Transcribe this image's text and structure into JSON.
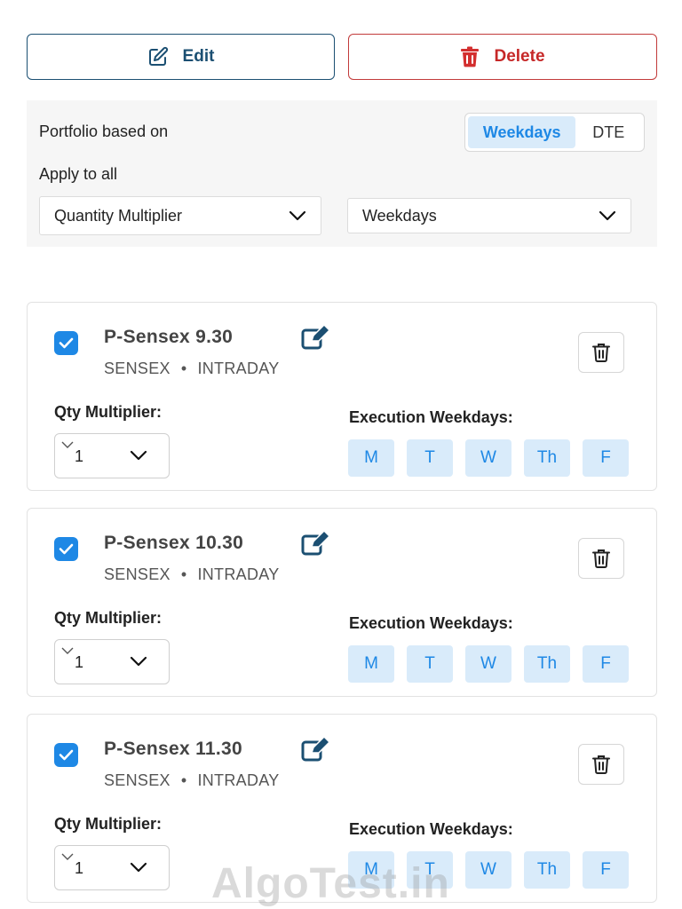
{
  "actions": {
    "edit_label": "Edit",
    "delete_label": "Delete"
  },
  "settings": {
    "based_on_label": "Portfolio based on",
    "based_on_options": [
      "Weekdays",
      "DTE"
    ],
    "based_on_selected": "Weekdays",
    "apply_all_label": "Apply to all",
    "apply_field": "Quantity Multiplier",
    "apply_basis": "Weekdays"
  },
  "strategies": [
    {
      "name": "P-Sensex 9.30",
      "index": "SENSEX",
      "type": "INTRADAY",
      "checked": true,
      "qty_label": "Qty Multiplier:",
      "qty": "1",
      "exec_label": "Execution Weekdays:",
      "days": [
        "M",
        "T",
        "W",
        "Th",
        "F"
      ]
    },
    {
      "name": "P-Sensex 10.30",
      "index": "SENSEX",
      "type": "INTRADAY",
      "checked": true,
      "qty_label": "Qty Multiplier:",
      "qty": "1",
      "exec_label": "Execution Weekdays:",
      "days": [
        "M",
        "T",
        "W",
        "Th",
        "F"
      ]
    },
    {
      "name": "P-Sensex 11.30",
      "index": "SENSEX",
      "type": "INTRADAY",
      "checked": true,
      "qty_label": "Qty Multiplier:",
      "qty": "1",
      "exec_label": "Execution Weekdays:",
      "days": [
        "M",
        "T",
        "W",
        "Th",
        "F"
      ]
    }
  ],
  "colors": {
    "primary": "#1e88e5",
    "primary_light": "#d9ebfa",
    "danger": "#c62828",
    "edit_border": "#1b4f72"
  },
  "icons": {
    "edit": "edit-square-icon",
    "delete": "trash-icon",
    "check": "check-icon",
    "pen": "pen-square-icon",
    "dropdown": "chevron-down-icon"
  },
  "watermark": "AlgoTest.in"
}
